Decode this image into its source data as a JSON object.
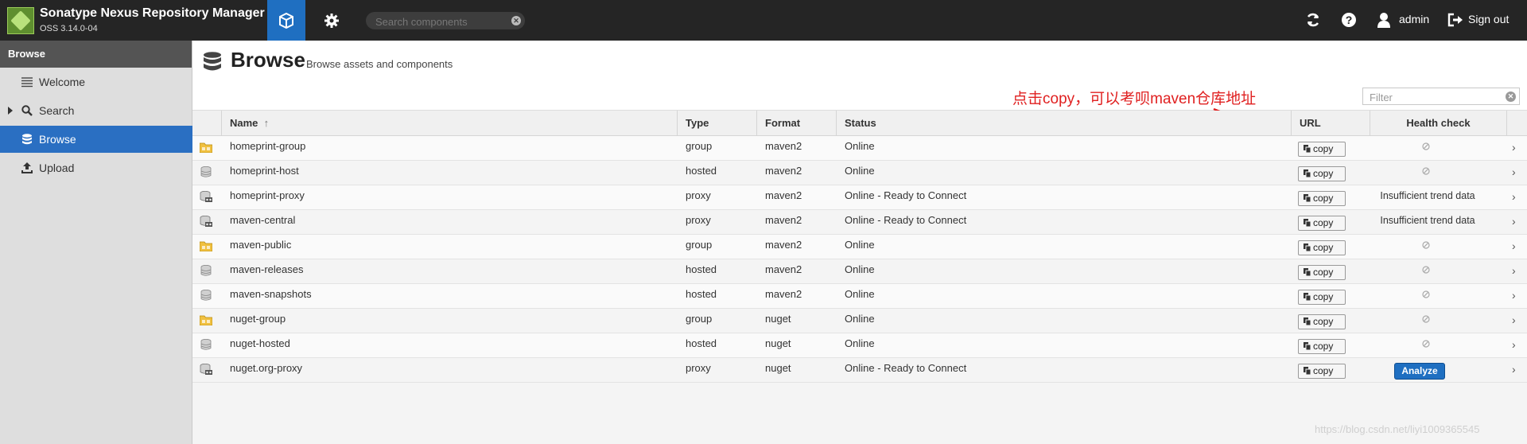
{
  "header": {
    "app_title": "Sonatype Nexus Repository Manager",
    "app_version": "OSS 3.14.0-04",
    "search_placeholder": "Search components",
    "user_name": "admin",
    "sign_out_label": "Sign out"
  },
  "sidebar": {
    "heading": "Browse",
    "items": [
      {
        "label": "Welcome",
        "icon": "welcome-list-icon",
        "active": false
      },
      {
        "label": "Search",
        "icon": "search-icon",
        "active": false
      },
      {
        "label": "Browse",
        "icon": "database-icon",
        "active": true
      },
      {
        "label": "Upload",
        "icon": "upload-icon",
        "active": false
      }
    ]
  },
  "main": {
    "title": "Browse",
    "subtitle": "Browse assets and components",
    "annotation": "点击copy，可以考呗maven仓库地址",
    "filter_placeholder": "Filter",
    "columns": {
      "name": "Name",
      "type": "Type",
      "format": "Format",
      "status": "Status",
      "url": "URL",
      "health": "Health check"
    },
    "copy_label": "copy",
    "analyze_label": "Analyze",
    "rows": [
      {
        "name": "homeprint-group",
        "type": "group",
        "format": "maven2",
        "status": "Online",
        "health": "",
        "repo_icon": "group-folder-icon"
      },
      {
        "name": "homeprint-host",
        "type": "hosted",
        "format": "maven2",
        "status": "Online",
        "health": "",
        "repo_icon": "hosted-database-icon"
      },
      {
        "name": "homeprint-proxy",
        "type": "proxy",
        "format": "maven2",
        "status": "Online - Ready to Connect",
        "health": "Insufficient trend data",
        "repo_icon": "proxy-server-icon"
      },
      {
        "name": "maven-central",
        "type": "proxy",
        "format": "maven2",
        "status": "Online - Ready to Connect",
        "health": "Insufficient trend data",
        "repo_icon": "proxy-server-icon"
      },
      {
        "name": "maven-public",
        "type": "group",
        "format": "maven2",
        "status": "Online",
        "health": "",
        "repo_icon": "group-folder-icon"
      },
      {
        "name": "maven-releases",
        "type": "hosted",
        "format": "maven2",
        "status": "Online",
        "health": "",
        "repo_icon": "hosted-database-icon"
      },
      {
        "name": "maven-snapshots",
        "type": "hosted",
        "format": "maven2",
        "status": "Online",
        "health": "",
        "repo_icon": "hosted-database-icon"
      },
      {
        "name": "nuget-group",
        "type": "group",
        "format": "nuget",
        "status": "Online",
        "health": "",
        "repo_icon": "group-folder-icon"
      },
      {
        "name": "nuget-hosted",
        "type": "hosted",
        "format": "nuget",
        "status": "Online",
        "health": "",
        "repo_icon": "hosted-database-icon"
      },
      {
        "name": "nuget.org-proxy",
        "type": "proxy",
        "format": "nuget",
        "status": "Online - Ready to Connect",
        "health": "analyze",
        "repo_icon": "proxy-server-icon"
      }
    ]
  },
  "watermark": "https://blog.csdn.net/liyi1009365545",
  "colors": {
    "header_bg": "#252525",
    "accent_blue": "#1f6fc1",
    "annotation_red": "#e02020",
    "folder_yellow": "#f0c040"
  }
}
